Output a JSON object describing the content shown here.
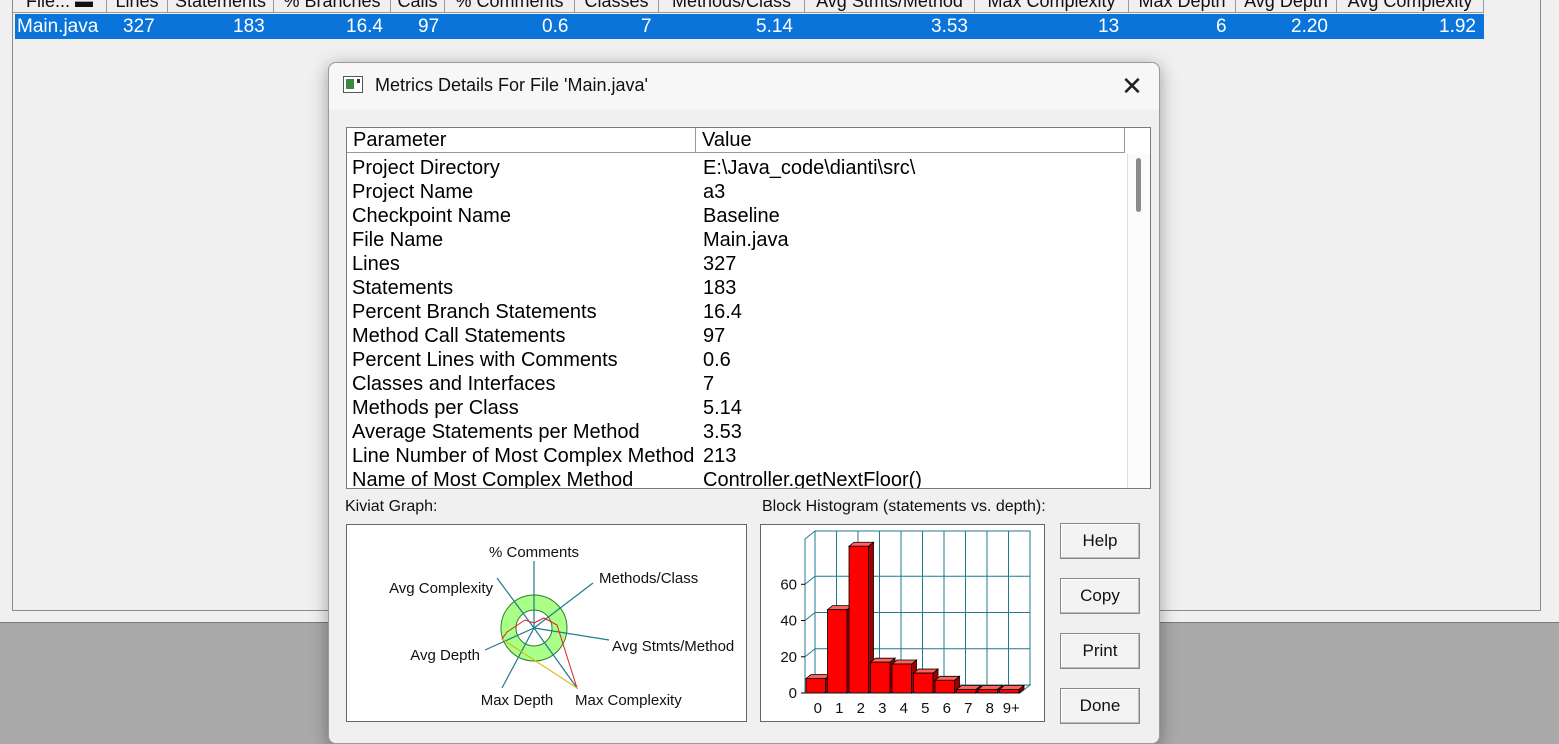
{
  "file_table": {
    "columns": [
      "File... ▬",
      "Lines",
      "Statements",
      "% Branches",
      "Calls",
      "% Comments",
      "Classes",
      "Methods/Class",
      "Avg Stmts/Method",
      "Max Complexity",
      "Max Depth",
      "Avg Depth",
      "Avg Complexity"
    ],
    "row": [
      "Main.java",
      "327",
      "183",
      "16.4",
      "97",
      "0.6",
      "7",
      "5.14",
      "3.53",
      "13",
      "6",
      "2.20",
      "1.92"
    ]
  },
  "dialog": {
    "title": "Metrics Details For File 'Main.java'",
    "close_glyph": "✕",
    "details": {
      "headers": [
        "Parameter",
        "Value"
      ],
      "rows": [
        [
          "Project Directory",
          "E:\\Java_code\\dianti\\src\\"
        ],
        [
          "Project Name",
          "a3"
        ],
        [
          "Checkpoint Name",
          "Baseline"
        ],
        [
          "File Name",
          "Main.java"
        ],
        [
          "Lines",
          "327"
        ],
        [
          "Statements",
          "183"
        ],
        [
          "Percent Branch Statements",
          "16.4"
        ],
        [
          "Method Call Statements",
          "97"
        ],
        [
          "Percent Lines with Comments",
          "0.6"
        ],
        [
          "Classes and Interfaces",
          "7"
        ],
        [
          "Methods per Class",
          "5.14"
        ],
        [
          "Average Statements per Method",
          "3.53"
        ],
        [
          "Line Number of Most Complex Method",
          "213"
        ],
        [
          "Name of Most Complex Method",
          "Controller.getNextFloor()"
        ]
      ]
    },
    "kiviat_label": "Kiviat Graph:",
    "histogram_label": "Block Histogram (statements vs. depth):",
    "kiviat": {
      "axes": [
        "% Comments",
        "Methods/Class",
        "Avg Stmts/Method",
        "Max Complexity",
        "Max Depth",
        "Avg Depth",
        "Avg Complexity"
      ]
    },
    "buttons": {
      "help": "Help",
      "copy": "Copy",
      "print": "Print",
      "done": "Done"
    }
  },
  "chart_data": {
    "type": "bar",
    "title": "Block Histogram (statements vs. depth)",
    "categories": [
      "0",
      "1",
      "2",
      "3",
      "4",
      "5",
      "6",
      "7",
      "8",
      "9+"
    ],
    "values": [
      8,
      46,
      81,
      17,
      16,
      11,
      7,
      2,
      2,
      2
    ],
    "y_ticks": [
      "0",
      "20",
      "40",
      "60"
    ],
    "ylim": [
      0,
      85
    ],
    "grid": true,
    "bar_color": "#ff0000"
  }
}
